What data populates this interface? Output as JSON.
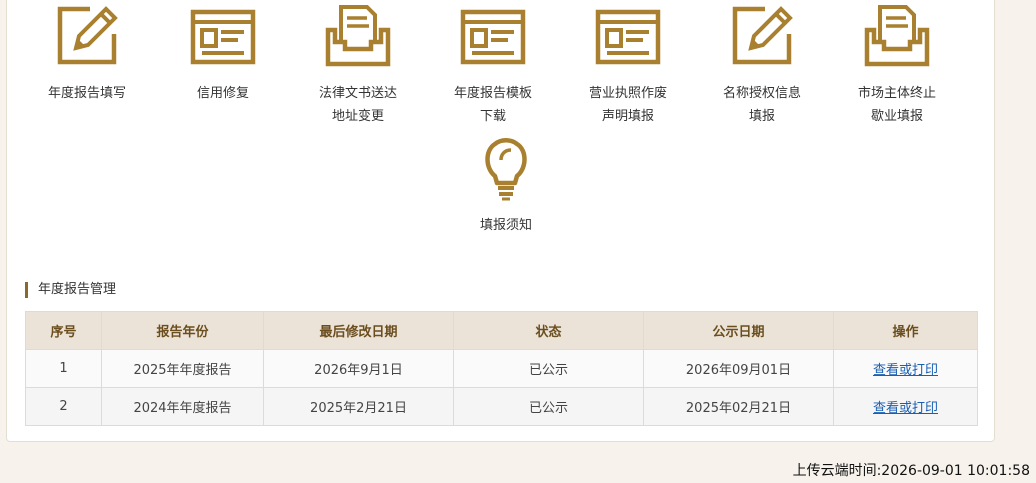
{
  "accent_color": "#a8802f",
  "tiles": [
    {
      "icon": "pencil-square-icon",
      "line1": "年度报告填写",
      "line2": ""
    },
    {
      "icon": "form-window-icon",
      "line1": "信用修复",
      "line2": ""
    },
    {
      "icon": "document-tray-icon",
      "line1": "法律文书送达",
      "line2": "地址变更"
    },
    {
      "icon": "form-window-icon",
      "line1": "年度报告模板",
      "line2": "下载"
    },
    {
      "icon": "form-window-icon",
      "line1": "营业执照作废",
      "line2": "声明填报"
    },
    {
      "icon": "pencil-square-icon",
      "line1": "名称授权信息",
      "line2": "填报"
    },
    {
      "icon": "document-tray-icon",
      "line1": "市场主体终止",
      "line2": "歇业填报"
    },
    {
      "icon": "lightbulb-icon",
      "line1": "填报须知",
      "line2": ""
    }
  ],
  "section": {
    "title": "年度报告管理"
  },
  "table": {
    "headers": [
      "序号",
      "报告年份",
      "最后修改日期",
      "状态",
      "公示日期",
      "操作"
    ],
    "rows": [
      [
        "1",
        "2025年年度报告",
        "2026年9月1日",
        "已公示",
        "2026年09月01日",
        "查看或打印"
      ],
      [
        "2",
        "2024年年度报告",
        "2025年2月21日",
        "已公示",
        "2025年02月21日",
        "查看或打印"
      ]
    ]
  },
  "footer": {
    "upload_time": "上传云端时间:2026-09-01 10:01:58"
  }
}
